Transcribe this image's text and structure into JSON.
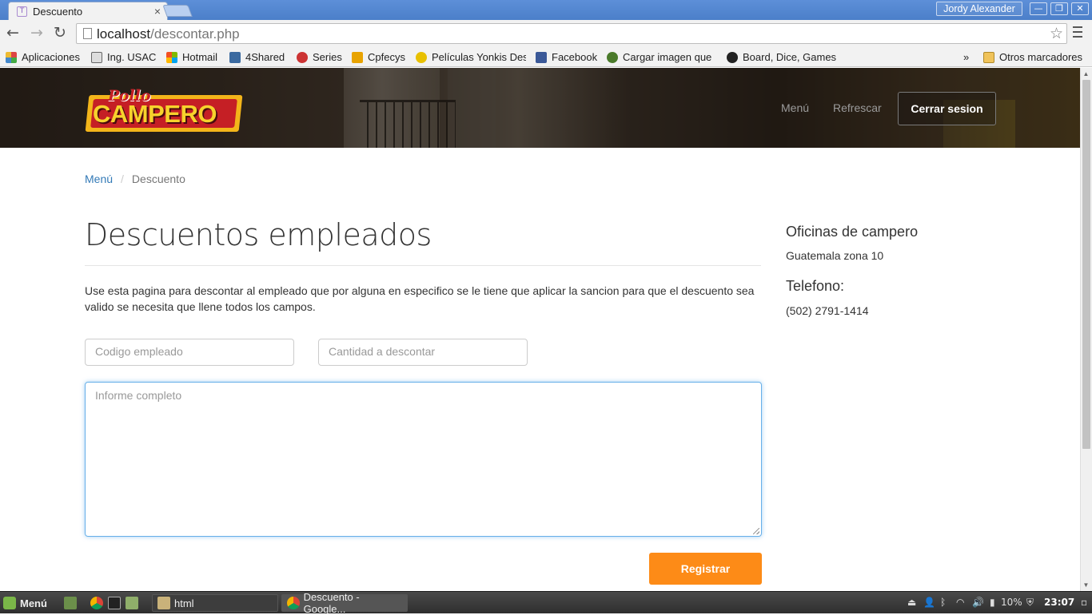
{
  "browser": {
    "tab_title": "Descuento",
    "tab_favicon_letter": "T",
    "tab_close": "×",
    "profile_name": "Jordy Alexander",
    "window_buttons": {
      "minimize": "—",
      "maximize": "❐",
      "close": "✕"
    },
    "url_host": "localhost",
    "url_path": "/descontar.php",
    "nav": {
      "back": "←",
      "forward": "→",
      "reload": "↻",
      "star": "☆"
    },
    "bookmarks": [
      {
        "label": "Aplicaciones",
        "icon": "apps-grid-icon",
        "color": "#d44"
      },
      {
        "label": "Ing. USAC",
        "icon": "usac-icon",
        "color": "#666"
      },
      {
        "label": "Hotmail",
        "icon": "windows-icon",
        "color": "#f25022"
      },
      {
        "label": "4Shared",
        "icon": "4shared-icon",
        "color": "#3b6aa0"
      },
      {
        "label": "Series",
        "icon": "series-icon",
        "color": "#c33"
      },
      {
        "label": "Cpfecys",
        "icon": "cpfecys-icon",
        "color": "#e8a300"
      },
      {
        "label": "Películas Yonkis Des",
        "icon": "yonkis-icon",
        "color": "#e8c000"
      },
      {
        "label": "Facebook",
        "icon": "facebook-icon",
        "color": "#3b5998"
      },
      {
        "label": "Cargar imagen que",
        "icon": "image-upload-icon",
        "color": "#4a7a2a"
      },
      {
        "label": "Board, Dice, Games",
        "icon": "board-game-icon",
        "color": "#222"
      }
    ],
    "bookmarks_overflow": "»",
    "other_bookmarks": "Otros marcadores"
  },
  "site": {
    "logo_pollo": "Pollo",
    "logo_campero": "CAMPERO",
    "nav_menu": "Menú",
    "nav_refresh": "Refrescar",
    "logout": "Cerrar sesion"
  },
  "breadcrumb": {
    "home": "Menú",
    "current": "Descuento",
    "separator": "/"
  },
  "main": {
    "title": "Descuentos empleados",
    "intro": "Use esta pagina para descontar al empleado que por alguna en especifico se le tiene que aplicar la sancion para que el descuento sea valido se necesita que llene todos los campos.",
    "codigo_placeholder": "Codigo empleado",
    "cantidad_placeholder": "Cantidad a descontar",
    "informe_placeholder": "Informe completo",
    "register_button": "Registrar"
  },
  "sidebar": {
    "office_heading": "Oficinas de campero",
    "office_city": "Guatemala zona 10",
    "phone_heading": "Telefono:",
    "phone": "(502) 2791-1414"
  },
  "taskbar": {
    "menu_label": "Menú",
    "windows": [
      {
        "label": "html"
      },
      {
        "label": "Descuento - Google..."
      }
    ],
    "battery": "10%",
    "clock": "23:07"
  },
  "colors": {
    "accent_orange": "#fd8b17",
    "link_blue": "#337ab7",
    "focus_blue": "#66afe9"
  }
}
